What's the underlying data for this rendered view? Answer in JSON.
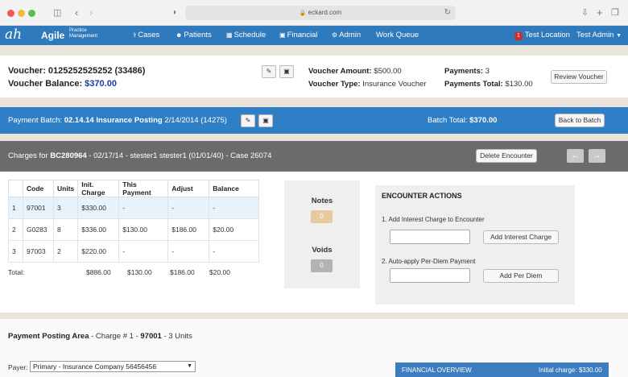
{
  "browser": {
    "url": "eckard.com",
    "colors": {
      "close": "#ee5b55",
      "minimize": "#f5b93a",
      "maximize": "#53c247"
    }
  },
  "nav": {
    "logo": "ah",
    "brand": "Agile",
    "brand_sub_1": "Practice",
    "brand_sub_2": "Management",
    "items": [
      {
        "label": "Cases",
        "icon": "stethoscope-icon"
      },
      {
        "label": "Patients",
        "icon": "user-icon"
      },
      {
        "label": "Schedule",
        "icon": "calendar-icon"
      },
      {
        "label": "Financial",
        "icon": "money-icon"
      },
      {
        "label": "Admin",
        "icon": "gears-icon"
      },
      {
        "label": "Work Queue",
        "icon": ""
      }
    ],
    "location_badge": "1",
    "location": "Test Location",
    "user": "Test Admin"
  },
  "voucher": {
    "title": "Voucher: 0125252525252 (33486)",
    "balance_label": "Voucher Balance:",
    "balance": "$370.00",
    "amount_label": "Voucher Amount:",
    "amount": "$500.00",
    "type_label": "Voucher Type:",
    "type": "Insurance Voucher",
    "payments_label": "Payments:",
    "payments": "3",
    "payments_total_label": "Payments Total:",
    "payments_total": "$130.00",
    "review_button": "Review Voucher"
  },
  "batch": {
    "label": "Payment Batch:",
    "name": "02.14.14 Insurance Posting",
    "detail": "2/14/2014 (14275)",
    "total_label": "Batch Total:",
    "total": "$370.00",
    "back_button": "Back to Batch",
    "accent": "#2e7fc5"
  },
  "charges": {
    "label": "Charges for",
    "code": "BC280964",
    "info": "- 02/17/14 - stester1 stester1 (01/01/40) - Case 26074",
    "delete_button": "Delete Encounter",
    "table": {
      "headers": [
        "",
        "Code",
        "Units",
        "Init. Charge",
        "This Payment",
        "Adjust",
        "Balance"
      ],
      "rows": [
        [
          "1",
          "97001",
          "3",
          "$330.00",
          "-",
          "-",
          "-"
        ],
        [
          "2",
          "G0283",
          "8",
          "$336.00",
          "$130.00",
          "$186.00",
          "$20.00"
        ],
        [
          "3",
          "97003",
          "2",
          "$220.00",
          "-",
          "-",
          "-"
        ]
      ]
    },
    "totals": {
      "label": "Total:",
      "init_charge": "$886.00",
      "this_payment": "$130.00",
      "adjust": "$186.00",
      "balance": "$20.00"
    },
    "notes_label": "Notes",
    "notes_count": "0",
    "voids_label": "Voids",
    "voids_count": "0",
    "colors": {
      "notes": "#e9c9a0",
      "voids": "#b3b3b3",
      "green_values": "#2e8b2e"
    }
  },
  "encounter_actions": {
    "title": "ENCOUNTER ACTIONS",
    "step1": "1. Add Interest Charge to Encounter",
    "step1_button": "Add Interest Charge",
    "step2": "2. Auto-apply Per-Diem Payment",
    "step2_button": "Add Per Diem"
  },
  "posting": {
    "title": "Payment Posting Area",
    "detail_prefix": "- Charge # 1 -",
    "code": "97001",
    "units": "- 3 Units",
    "payer_label": "Payer:",
    "payer_value": "Primary - Insurance Company 56456456",
    "financial_overview": "FINANCIAL OVERVIEW",
    "initial_charge_label": "Initial charge:",
    "initial_charge": "$330.00"
  }
}
